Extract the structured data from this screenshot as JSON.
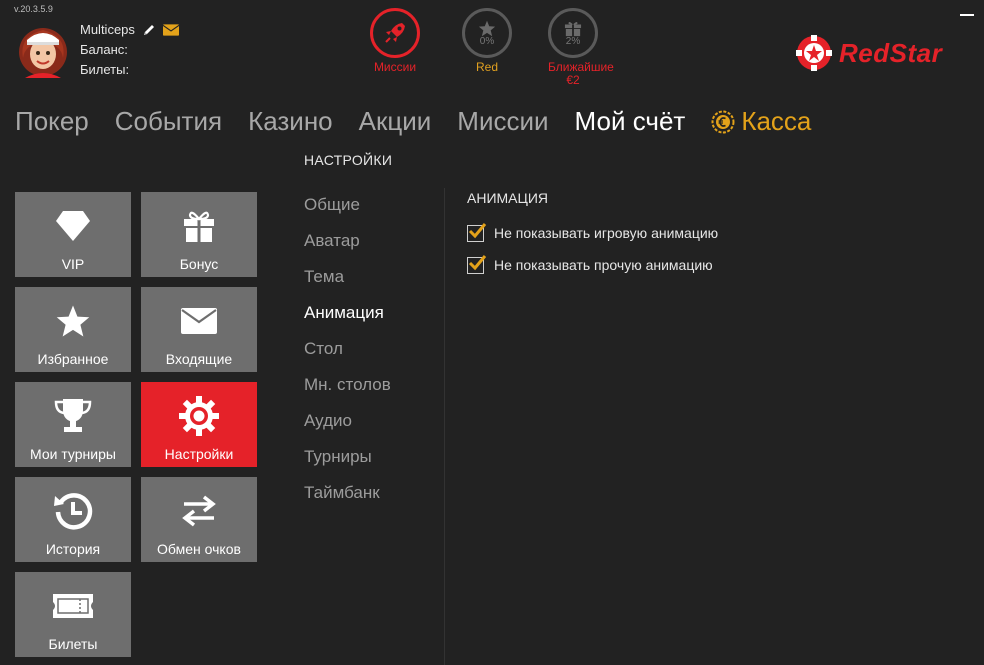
{
  "app": {
    "version": "v.20.3.5.9"
  },
  "user": {
    "name": "Multiceps",
    "balance_label": "Баланс:",
    "tickets_label": "Билеты:"
  },
  "status": {
    "missions": {
      "label": "Миссии"
    },
    "red": {
      "label": "Red",
      "percent": "0%"
    },
    "nearest": {
      "label_line1": "Ближайшие",
      "label_line2": "€2",
      "percent": "2%"
    }
  },
  "logo": {
    "text": "RedStar"
  },
  "nav": {
    "items": [
      {
        "label": "Покер"
      },
      {
        "label": "События"
      },
      {
        "label": "Казино"
      },
      {
        "label": "Акции"
      },
      {
        "label": "Миссии"
      },
      {
        "label": "Мой счёт"
      }
    ],
    "cashier": {
      "label": "Касса"
    }
  },
  "tiles": [
    {
      "label": "VIP",
      "icon": "diamond-icon"
    },
    {
      "label": "Бонус",
      "icon": "gift-icon"
    },
    {
      "label": "Избранное",
      "icon": "star-icon"
    },
    {
      "label": "Входящие",
      "icon": "envelope-icon"
    },
    {
      "label": "Мои турниры",
      "icon": "trophy-icon"
    },
    {
      "label": "Настройки",
      "icon": "gear-icon"
    },
    {
      "label": "История",
      "icon": "history-icon"
    },
    {
      "label": "Обмен очков",
      "icon": "exchange-icon"
    },
    {
      "label": "Билеты",
      "icon": "ticket-icon"
    }
  ],
  "settings": {
    "title": "НАСТРОЙКИ",
    "menu": [
      {
        "label": "Общие"
      },
      {
        "label": "Аватар"
      },
      {
        "label": "Тема"
      },
      {
        "label": "Анимация"
      },
      {
        "label": "Стол"
      },
      {
        "label": "Мн. столов"
      },
      {
        "label": "Аудио"
      },
      {
        "label": "Турниры"
      },
      {
        "label": "Таймбанк"
      }
    ]
  },
  "animation": {
    "title": "АНИМАЦИЯ",
    "options": [
      {
        "label": "Не показывать игровую анимацию",
        "checked": true
      },
      {
        "label": "Не показывать прочую анимацию",
        "checked": true
      }
    ]
  },
  "colors": {
    "accent_red": "#e52229",
    "accent_gold": "#e3a21a",
    "tile_gray": "#6e6e6e",
    "background": "#222222"
  }
}
